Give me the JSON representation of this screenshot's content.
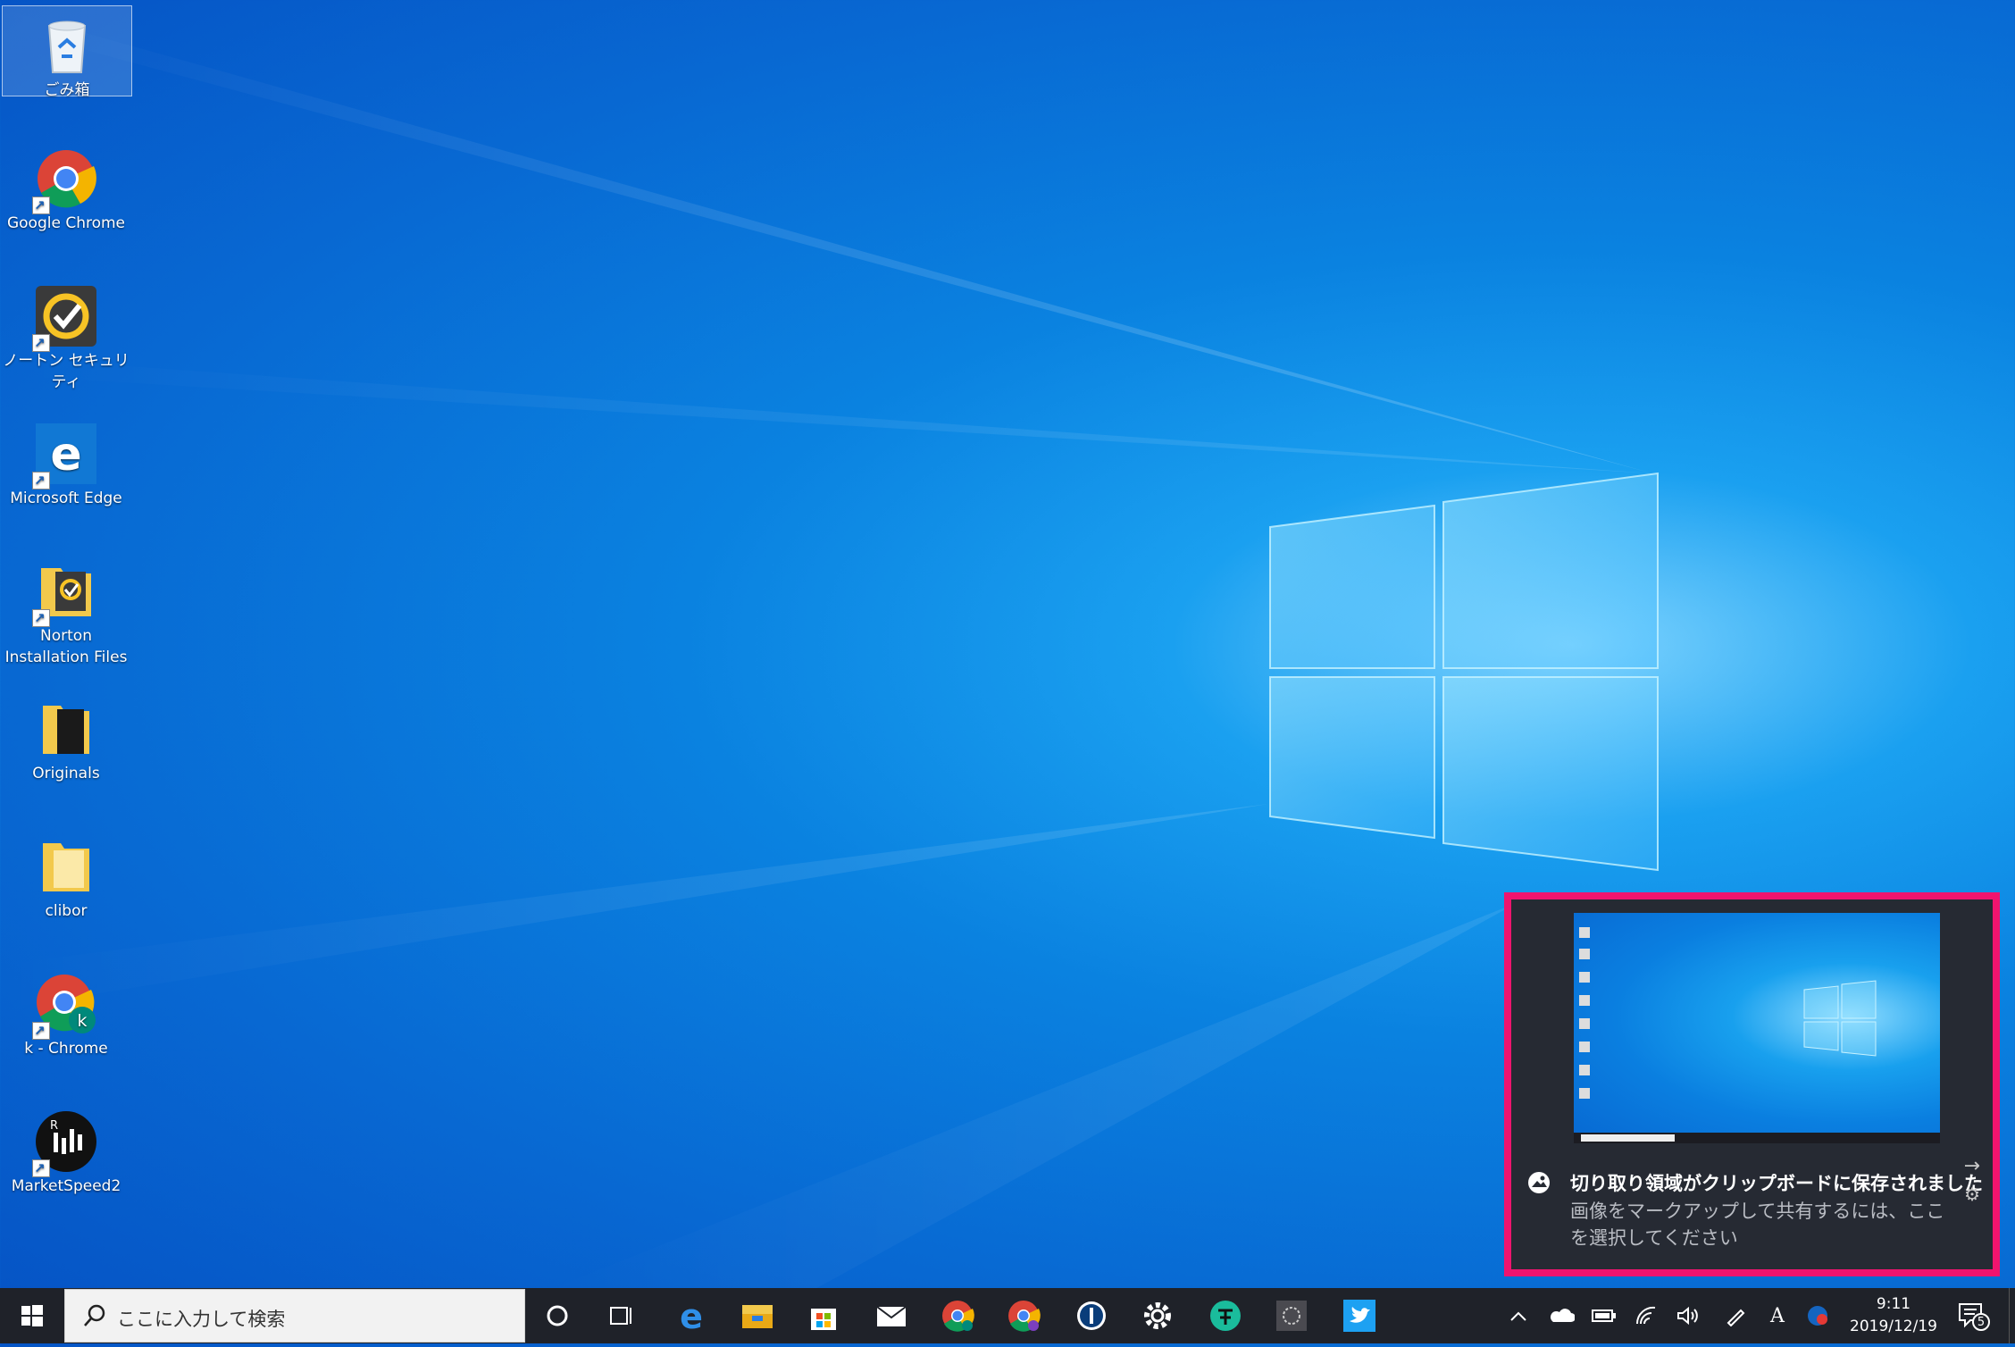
{
  "desktop": {
    "icons": [
      {
        "label": "ごみ箱",
        "icon": "recycle-bin-icon"
      },
      {
        "label": "Google Chrome",
        "icon": "chrome-icon"
      },
      {
        "label": "ノートン セキュリティ",
        "icon": "norton-security-icon"
      },
      {
        "label": "Microsoft Edge",
        "icon": "edge-icon"
      },
      {
        "label": "Norton Installation Files",
        "icon": "norton-installation-folder-icon"
      },
      {
        "label": "Originals",
        "icon": "folder-icon"
      },
      {
        "label": "clibor",
        "icon": "folder-icon"
      },
      {
        "label": "k - Chrome",
        "icon": "chrome-profile-icon",
        "badge": "k"
      },
      {
        "label": "MarketSpeed2",
        "icon": "marketspeed-icon",
        "badge": "R"
      }
    ]
  },
  "notification": {
    "title": "切り取り領域がクリップボードに保存されました",
    "body": "画像をマークアップして共有するには、ここを選択してください",
    "highlight_color": "#f0146e"
  },
  "taskbar": {
    "search_placeholder": "ここに入力して検索",
    "pinned": [
      "cortana-icon",
      "task-view-icon",
      "edge-icon",
      "file-explorer-icon",
      "store-icon",
      "mail-icon",
      "chrome-icon",
      "chrome-profile-icon",
      "1password-icon",
      "settings-icon",
      "app-icon",
      "snip-icon",
      "twitter-icon"
    ],
    "tray": {
      "ime_label": "A",
      "time": "9:11",
      "date": "2019/12/19",
      "notification_count": "5"
    }
  },
  "colors": {
    "accent": "#0078d7",
    "taskbar": "#1f2229"
  }
}
